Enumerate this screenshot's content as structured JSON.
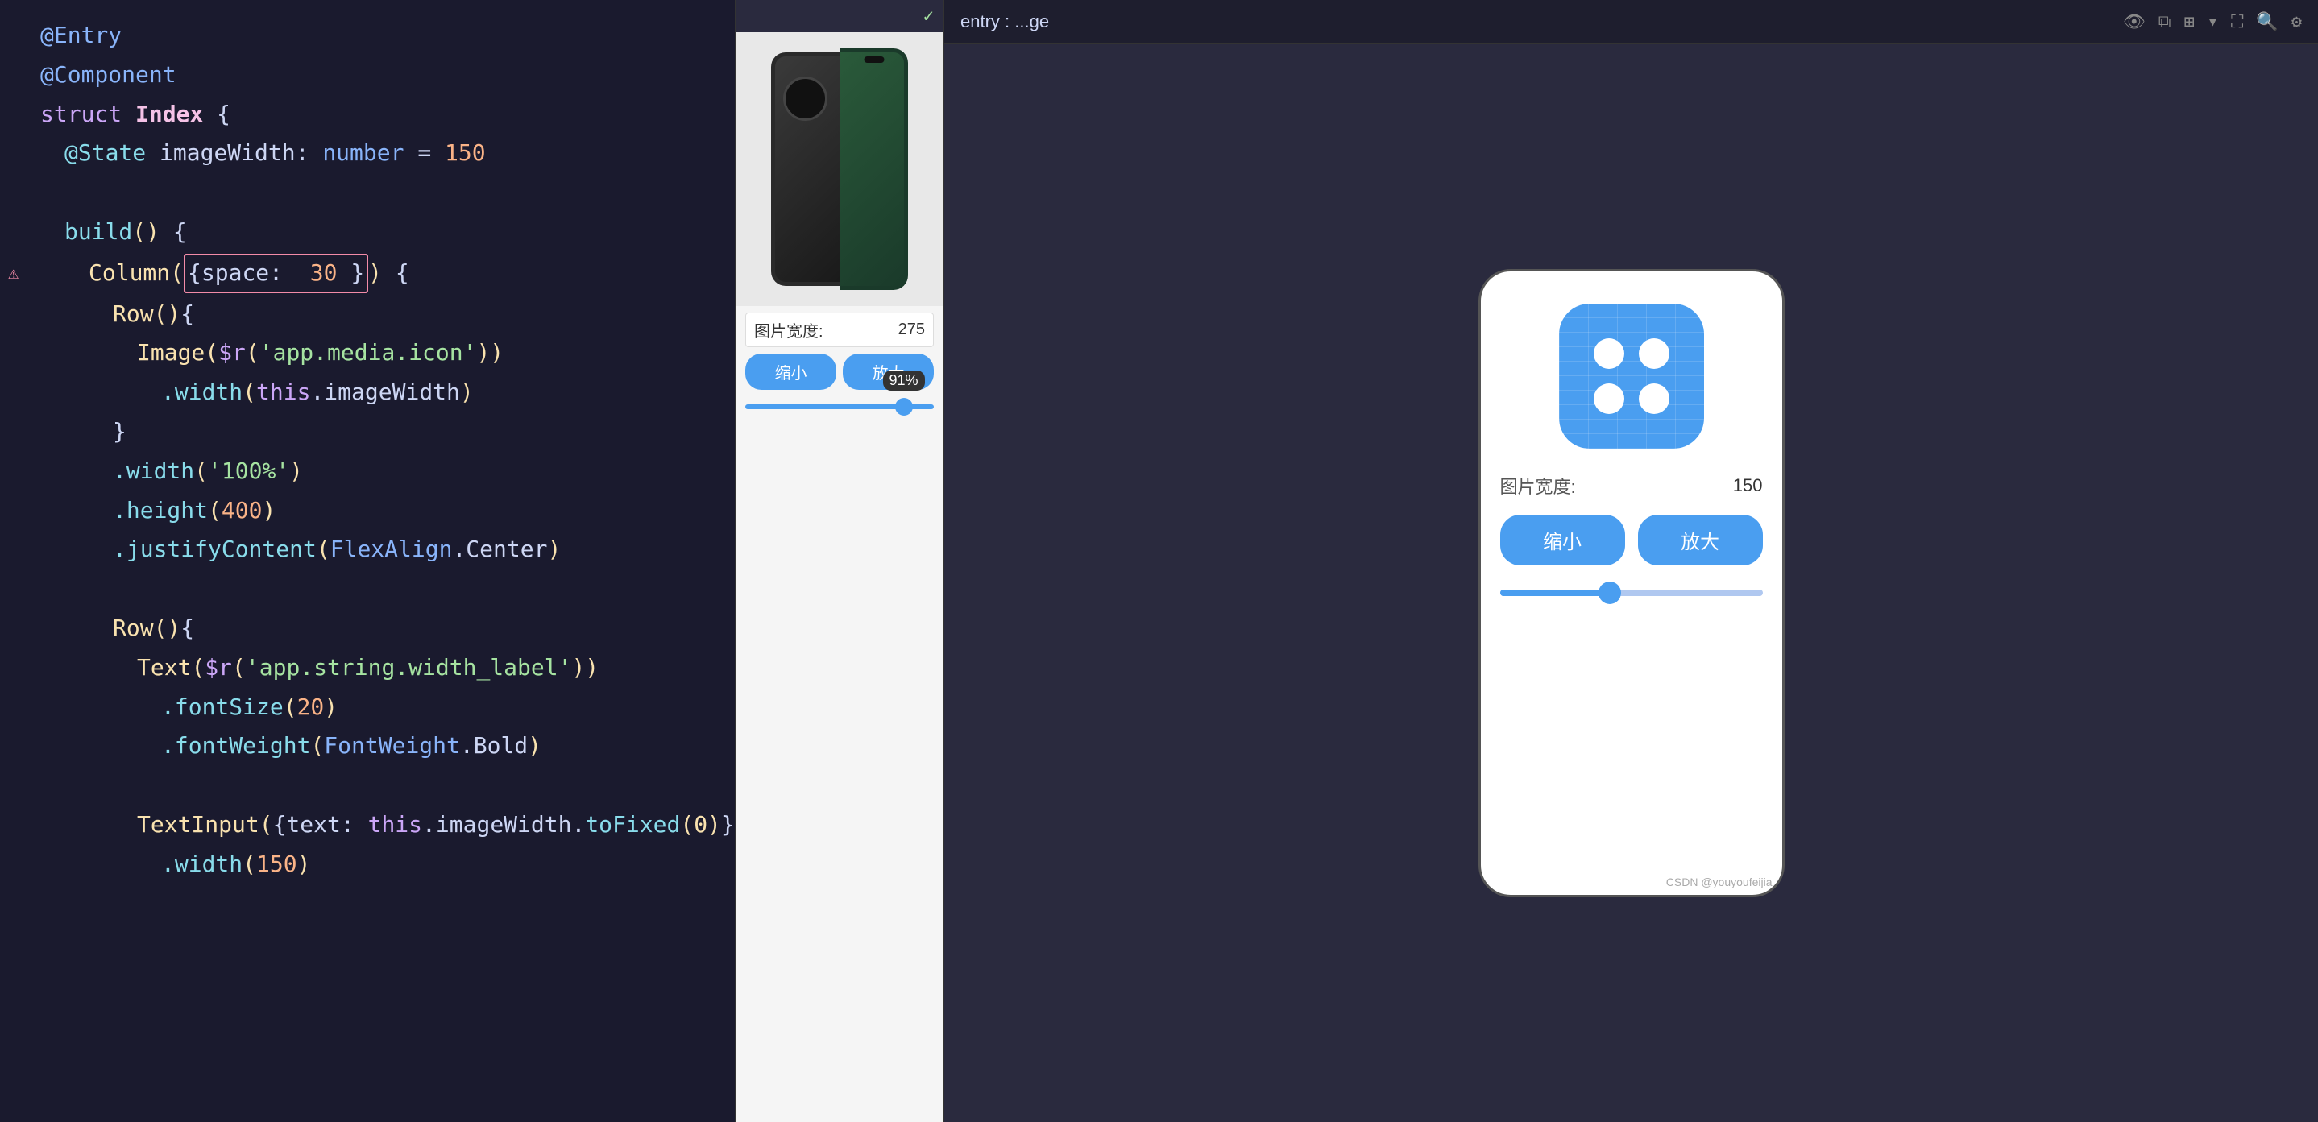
{
  "toolbar": {
    "entry_label": "entry : ...ge",
    "checkmark": "✓"
  },
  "code": {
    "lines": [
      {
        "indent": 0,
        "tokens": [
          {
            "type": "decorator",
            "text": "@Entry"
          }
        ]
      },
      {
        "indent": 0,
        "tokens": [
          {
            "type": "decorator",
            "text": "@Component"
          }
        ]
      },
      {
        "indent": 0,
        "tokens": [
          {
            "type": "keyword",
            "text": "struct"
          },
          {
            "type": "space",
            "text": " "
          },
          {
            "type": "struct-name",
            "text": "Index"
          },
          {
            "type": "white",
            "text": " {"
          }
        ]
      },
      {
        "indent": 1,
        "tokens": [
          {
            "type": "state",
            "text": "@State"
          },
          {
            "type": "space",
            "text": " "
          },
          {
            "type": "white",
            "text": "imageWidth:"
          },
          {
            "type": "space",
            "text": " "
          },
          {
            "type": "type",
            "text": "number"
          },
          {
            "type": "space",
            "text": " = "
          },
          {
            "type": "number",
            "text": "150"
          }
        ]
      },
      {
        "indent": 0,
        "tokens": []
      },
      {
        "indent": 1,
        "tokens": [
          {
            "type": "method",
            "text": "build"
          },
          {
            "type": "paren",
            "text": "()"
          },
          {
            "type": "white",
            "text": " {"
          }
        ]
      },
      {
        "indent": 2,
        "error": true,
        "tokens": [
          {
            "type": "component",
            "text": "Column"
          },
          {
            "type": "paren",
            "text": "("
          },
          {
            "type": "highlight",
            "text": "{space: 30}"
          },
          {
            "type": "paren",
            "text": ")"
          },
          {
            "type": "white",
            "text": " {"
          }
        ]
      },
      {
        "indent": 3,
        "tokens": [
          {
            "type": "component",
            "text": "Row"
          },
          {
            "type": "paren",
            "text": "()"
          },
          {
            "type": "white",
            "text": "{"
          }
        ]
      },
      {
        "indent": 4,
        "tokens": [
          {
            "type": "component",
            "text": "Image"
          },
          {
            "type": "paren",
            "text": "("
          },
          {
            "type": "this",
            "text": "$r"
          },
          {
            "type": "paren",
            "text": "("
          },
          {
            "type": "string",
            "text": "'app.media.icon'"
          },
          {
            "type": "paren",
            "text": "))"
          }
        ]
      },
      {
        "indent": 5,
        "tokens": [
          {
            "type": "method",
            "text": ".width"
          },
          {
            "type": "paren",
            "text": "("
          },
          {
            "type": "this",
            "text": "this"
          },
          {
            "type": "white",
            "text": ".imageWidth"
          },
          {
            "type": "paren",
            "text": ")"
          }
        ]
      },
      {
        "indent": 3,
        "tokens": [
          {
            "type": "white",
            "text": "}"
          }
        ]
      },
      {
        "indent": 3,
        "tokens": [
          {
            "type": "method",
            "text": ".width"
          },
          {
            "type": "paren",
            "text": "("
          },
          {
            "type": "string",
            "text": "'100%'"
          },
          {
            "type": "paren",
            "text": ")"
          }
        ]
      },
      {
        "indent": 3,
        "tokens": [
          {
            "type": "method",
            "text": ".height"
          },
          {
            "type": "paren",
            "text": "("
          },
          {
            "type": "number",
            "text": "400"
          },
          {
            "type": "paren",
            "text": ")"
          }
        ]
      },
      {
        "indent": 3,
        "tokens": [
          {
            "type": "method",
            "text": ".justifyContent"
          },
          {
            "type": "paren",
            "text": "("
          },
          {
            "type": "type",
            "text": "FlexAlign"
          },
          {
            "type": "white",
            "text": ".Center"
          },
          {
            "type": "paren",
            "text": ")"
          }
        ]
      },
      {
        "indent": 0,
        "tokens": []
      },
      {
        "indent": 3,
        "tokens": [
          {
            "type": "component",
            "text": "Row"
          },
          {
            "type": "paren",
            "text": "()"
          },
          {
            "type": "white",
            "text": "{"
          }
        ]
      },
      {
        "indent": 4,
        "tokens": [
          {
            "type": "component",
            "text": "Text"
          },
          {
            "type": "paren",
            "text": "("
          },
          {
            "type": "this",
            "text": "$r"
          },
          {
            "type": "paren",
            "text": "("
          },
          {
            "type": "string",
            "text": "'app.string.width_label'"
          },
          {
            "type": "paren",
            "text": "))"
          }
        ]
      },
      {
        "indent": 5,
        "tokens": [
          {
            "type": "method",
            "text": ".fontSize"
          },
          {
            "type": "paren",
            "text": "("
          },
          {
            "type": "number",
            "text": "20"
          },
          {
            "type": "paren",
            "text": ")"
          }
        ]
      },
      {
        "indent": 5,
        "tokens": [
          {
            "type": "method",
            "text": ".fontWeight"
          },
          {
            "type": "paren",
            "text": "("
          },
          {
            "type": "type",
            "text": "FontWeight"
          },
          {
            "type": "white",
            "text": ".Bold"
          },
          {
            "type": "paren",
            "text": ")"
          }
        ]
      },
      {
        "indent": 0,
        "tokens": []
      },
      {
        "indent": 4,
        "tokens": [
          {
            "type": "component",
            "text": "TextInput"
          },
          {
            "type": "paren",
            "text": "("
          },
          {
            "type": "white",
            "text": "{text:"
          },
          {
            "type": "space",
            "text": " "
          },
          {
            "type": "this",
            "text": "this"
          },
          {
            "type": "white",
            "text": ".imageWidth."
          },
          {
            "type": "method",
            "text": "toFixed"
          },
          {
            "type": "paren",
            "text": "(0)"
          },
          {
            "type": "white",
            "text": "}"
          },
          {
            "type": "paren",
            "text": ")"
          }
        ]
      },
      {
        "indent": 5,
        "tokens": [
          {
            "type": "method",
            "text": ".width"
          },
          {
            "type": "paren",
            "text": "("
          },
          {
            "type": "number",
            "text": "150"
          },
          {
            "type": "paren",
            "text": ")"
          }
        ]
      }
    ]
  },
  "preview_middle": {
    "width_label": "图片宽度:",
    "width_value": "275",
    "btn_shrink": "缩小",
    "btn_enlarge": "放大",
    "slider_percent": "91%"
  },
  "preview_right": {
    "width_label": "图片宽度:",
    "width_value": "150",
    "btn_shrink": "缩小",
    "btn_enlarge": "放大",
    "watermark": "CSDN @youyoufeijia"
  },
  "colors": {
    "accent": "#4a9ef0",
    "background_dark": "#1a1a2e",
    "background_editor": "#1e1e2e",
    "text_light": "#cdd6f4"
  }
}
